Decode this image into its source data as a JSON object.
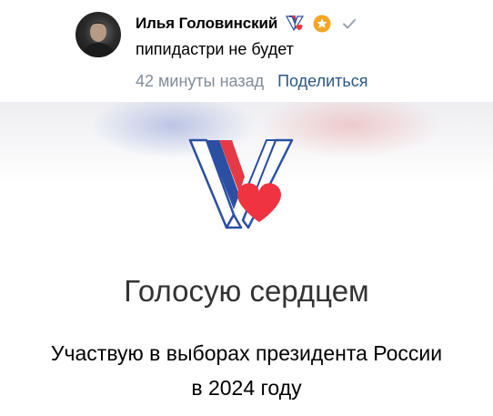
{
  "post": {
    "author": "Илья Головинский",
    "text": "пипидастри не будет",
    "time": "42 минуты назад",
    "share": "Поделиться"
  },
  "icons": {
    "badges": [
      "v-vote-badge-icon",
      "star-badge-icon",
      "verified-check-icon"
    ]
  },
  "card": {
    "title": "Голосую сердцем",
    "subtitle_line1": "Участвую в выборах президента России",
    "subtitle_line2": "в 2024 году"
  },
  "colors": {
    "link": "#2a5885",
    "muted": "#818c99",
    "heart": "#ef3340",
    "flag_blue": "#2b4fa3",
    "flag_red": "#e63946",
    "star": "#f5a623"
  }
}
